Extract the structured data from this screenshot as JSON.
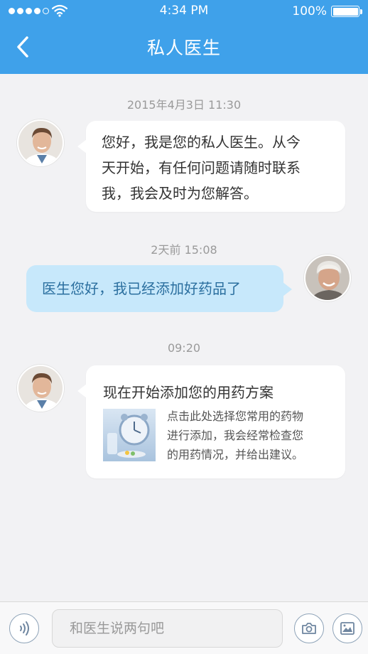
{
  "status_bar": {
    "time": "4:34 PM",
    "battery": "100%"
  },
  "nav": {
    "title": "私人医生"
  },
  "messages": [
    {
      "timestamp": "2015年4月3日   11:30",
      "lines": [
        "您好，我是您的私人医生。从今",
        "天开始，有任何问题请随时联系",
        "我，我会及时为您解答。"
      ]
    },
    {
      "timestamp": "2天前  15:08",
      "text": "医生您好，我已经添加好药品了"
    },
    {
      "timestamp": "09:20",
      "title": "现在开始添加您的用药方案",
      "desc_lines": [
        "点击此处选择您常用的药物",
        "进行添加，我会经常检查您",
        "的用药情况，并给出建议。"
      ]
    }
  ],
  "input": {
    "placeholder": "和医生说两句吧"
  },
  "icons": {
    "back": "chevron-left-icon",
    "voice": "voice-icon",
    "camera": "camera-icon",
    "image": "image-icon"
  },
  "colors": {
    "header": "#3fa1ea",
    "outgoing_bubble": "#c7e8fb",
    "outgoing_text": "#2b6f9f",
    "background": "#f2f2f4"
  }
}
